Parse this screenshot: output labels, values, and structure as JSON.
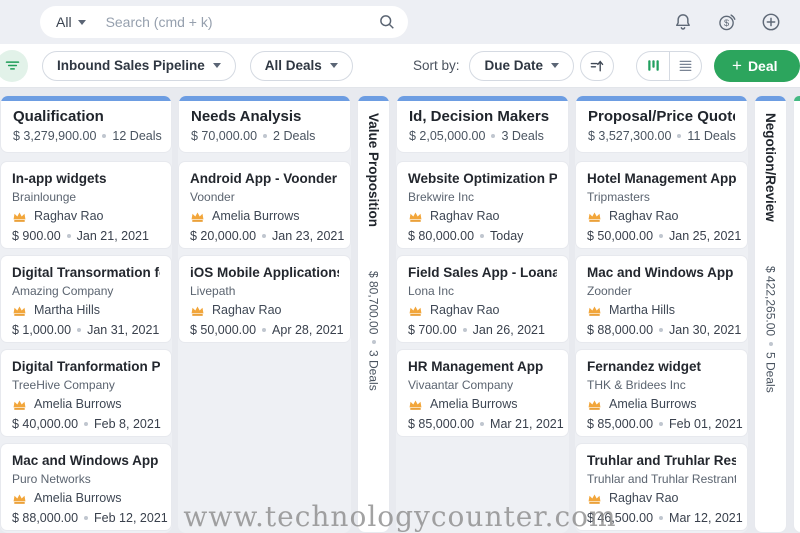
{
  "topbar": {
    "scope_label": "All",
    "search_placeholder": "Search (cmd + k)"
  },
  "toolbar": {
    "pipeline_filter": "Inbound Sales Pipeline",
    "deals_filter": "All Deals",
    "sort_by_label": "Sort by:",
    "sort_value": "Due Date",
    "deal_button_label": "Deal"
  },
  "colors": {
    "accent_green": "#2ca55d",
    "column_bar_blue": "#6d9de2",
    "column_bar_green": "#44b983",
    "crown_orange": "#f2a63b"
  },
  "board": {
    "columns": [
      {
        "name": "Qualification",
        "amount": "$ 3,279,900.00",
        "deals": "12 Deals",
        "collapsed": false,
        "bar_color": "#6d9de2",
        "cards": [
          {
            "title": "In-app widgets",
            "company": "Brainlounge",
            "owner": "Raghav Rao",
            "amount": "$ 900.00",
            "date": "Jan 21, 2021"
          },
          {
            "title": "Digital Transormation fo...",
            "company": "Amazing Company",
            "owner": "Martha Hills",
            "amount": "$ 1,000.00",
            "date": "Jan 31, 2021"
          },
          {
            "title": "Digital Tranformation Pr...",
            "company": "TreeHive Company",
            "owner": "Amelia Burrows",
            "amount": "$ 40,000.00",
            "date": "Feb 8, 2021"
          },
          {
            "title": "Mac and Windows App f...",
            "company": "Puro Networks",
            "owner": "Amelia Burrows",
            "amount": "$ 88,000.00",
            "date": "Feb 12, 2021"
          }
        ]
      },
      {
        "name": "Needs Analysis",
        "amount": "$ 70,000.00",
        "deals": "2 Deals",
        "collapsed": false,
        "bar_color": "#6d9de2",
        "cards": [
          {
            "title": "Android App - Voonder",
            "company": "Voonder",
            "owner": "Amelia Burrows",
            "amount": "$ 20,000.00",
            "date": "Jan 23, 2021"
          },
          {
            "title": "iOS Mobile Applications...",
            "company": "Livepath",
            "owner": "Raghav Rao",
            "amount": "$ 50,000.00",
            "date": "Apr 28, 2021"
          }
        ]
      },
      {
        "name": "Value Proposition",
        "amount": "$ 80,700.00",
        "deals": "3 Deals",
        "collapsed": true,
        "bar_color": "#6d9de2",
        "cards": []
      },
      {
        "name": "Id, Decision Makers",
        "amount": "$ 2,05,000.00",
        "deals": "3 Deals",
        "collapsed": false,
        "bar_color": "#6d9de2",
        "cards": [
          {
            "title": "Website Optimization Pr...",
            "company": "Brekwire Inc",
            "owner": "Raghav Rao",
            "amount": "$ 80,000.00",
            "date": "Today"
          },
          {
            "title": "Field Sales App - Loana Inc",
            "company": "Lona Inc",
            "owner": "Raghav Rao",
            "amount": "$ 700.00",
            "date": "Jan 26, 2021"
          },
          {
            "title": "HR Management App",
            "company": "Vivaantar Company",
            "owner": "Amelia Burrows",
            "amount": "$ 85,000.00",
            "date": "Mar 21, 2021"
          }
        ]
      },
      {
        "name": "Proposal/Price Quote",
        "amount": "$ 3,527,300.00",
        "deals": "11 Deals",
        "collapsed": false,
        "bar_color": "#6d9de2",
        "cards": [
          {
            "title": "Hotel Management App",
            "company": "Tripmasters",
            "owner": "Raghav Rao",
            "amount": "$ 50,000.00",
            "date": "Jan 25, 2021"
          },
          {
            "title": "Mac and Windows App",
            "company": "Zoonder",
            "owner": "Martha Hills",
            "amount": "$ 88,000.00",
            "date": "Jan 30, 2021"
          },
          {
            "title": "Fernandez widget",
            "company": "THK & Bridees Inc",
            "owner": "Amelia Burrows",
            "amount": "$ 85,000.00",
            "date": "Feb 01, 2021"
          },
          {
            "title": "Truhlar and Truhlar Rest...",
            "company": "Truhlar and Truhlar Restrant",
            "owner": "Raghav Rao",
            "amount": "$ 46,500.00",
            "date": "Mar 12, 2021"
          }
        ]
      },
      {
        "name": "Negotion/Review",
        "amount": "$ 422,265.00",
        "deals": "5 Deals",
        "collapsed": true,
        "bar_color": "#6d9de2",
        "cards": []
      },
      {
        "name": "",
        "amount": "",
        "deals": "",
        "collapsed": false,
        "partial": true,
        "bar_color": "#44b983",
        "cards": []
      }
    ]
  },
  "watermark": "www.technologycounter.com"
}
